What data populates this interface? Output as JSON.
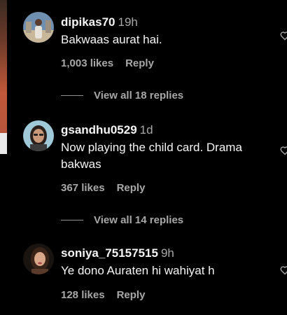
{
  "comments": [
    {
      "username": "dipikas70",
      "time": "19h",
      "text": "Bakwaas aurat hai.",
      "likes": "1,003 likes",
      "reply_label": "Reply",
      "view_replies": "View all 18 replies"
    },
    {
      "username": "gsandhu0529",
      "time": "1d",
      "text": "Now playing the child card. Drama bakwas",
      "likes": "367 likes",
      "reply_label": "Reply",
      "view_replies": "View all 14 replies"
    },
    {
      "username": "soniya_75157515",
      "time": "9h",
      "text": "Ye dono Auraten hi wahiyat h",
      "likes": "128 likes",
      "reply_label": "Reply"
    }
  ],
  "icons": {
    "like": "heart-outline-icon"
  },
  "colors": {
    "background": "#000000",
    "primary_text": "#f5f5f5",
    "secondary_text": "#a8a8a8"
  }
}
